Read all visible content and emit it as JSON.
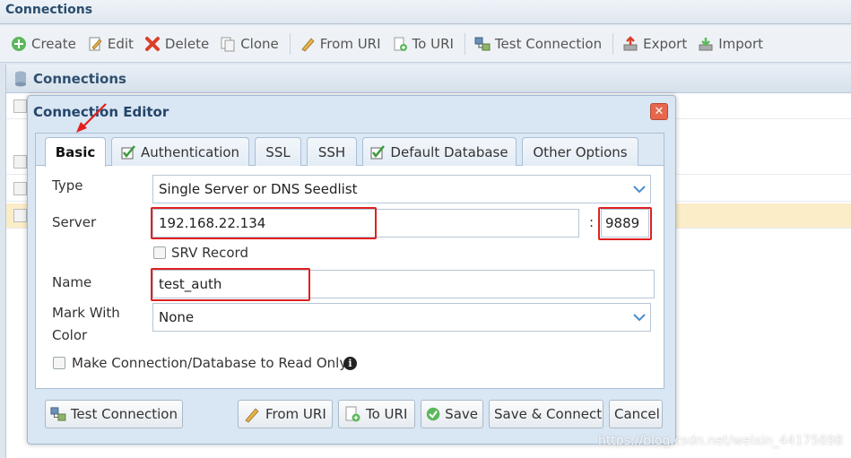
{
  "window": {
    "title": "Connections"
  },
  "toolbar": {
    "create": "Create",
    "edit": "Edit",
    "delete": "Delete",
    "clone": "Clone",
    "from_uri": "From URI",
    "to_uri": "To URI",
    "test_connection": "Test Connection",
    "export": "Export",
    "import": "Import"
  },
  "panel": {
    "title": "Connections"
  },
  "dialog": {
    "title": "Connection Editor",
    "tabs": [
      "Basic",
      "Authentication",
      "SSL",
      "SSH",
      "Default Database",
      "Other Options"
    ],
    "form": {
      "type_label": "Type",
      "type_value": "Single Server or DNS Seedlist",
      "server_label": "Server",
      "server_value": "192.168.22.134",
      "port_sep": ":",
      "port_value": "9889",
      "srv_label": "SRV Record",
      "name_label": "Name",
      "name_value": "test_auth",
      "mark_label_1": "Mark With",
      "mark_label_2": "Color",
      "mark_value": "None",
      "readonly_label": "Make Connection/Database to Read Only"
    },
    "buttons": {
      "test": "Test Connection",
      "from_uri": "From URI",
      "to_uri": "To URI",
      "save": "Save",
      "save_connect": "Save & Connect",
      "cancel": "Cancel"
    }
  },
  "watermark": "https://blog.csdn.net/weixin_44175698",
  "colors": {
    "accent": "#2a4d6e",
    "highlight": "#e02020",
    "selected_row": "#fbedc8"
  }
}
